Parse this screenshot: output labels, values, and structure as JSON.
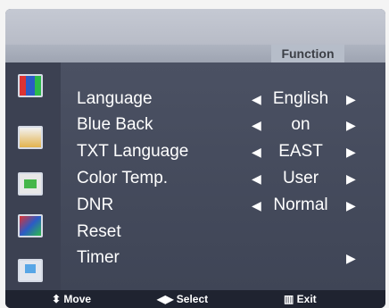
{
  "header": {
    "title": "Function"
  },
  "sidebar": {
    "icons": [
      {
        "name": "picture-icon"
      },
      {
        "name": "sound-icon"
      },
      {
        "name": "channel-icon"
      },
      {
        "name": "function-icon"
      },
      {
        "name": "screen-icon"
      }
    ]
  },
  "menu": {
    "items": [
      {
        "label": "Language",
        "value": "English",
        "left": "◀",
        "right": "▶"
      },
      {
        "label": "Blue Back",
        "value": "on",
        "left": "◀",
        "right": "▶"
      },
      {
        "label": "TXT Language",
        "value": "EAST",
        "left": "◀",
        "right": "▶"
      },
      {
        "label": "Color Temp.",
        "value": "User",
        "left": "◀",
        "right": "▶"
      },
      {
        "label": "DNR",
        "value": "Normal",
        "left": "◀",
        "right": "▶"
      },
      {
        "label": "Reset"
      },
      {
        "label": "Timer",
        "right": "▶"
      }
    ]
  },
  "footer": {
    "move": "⬍ Move",
    "select": "◀▶ Select",
    "exit": "▥ Exit"
  }
}
